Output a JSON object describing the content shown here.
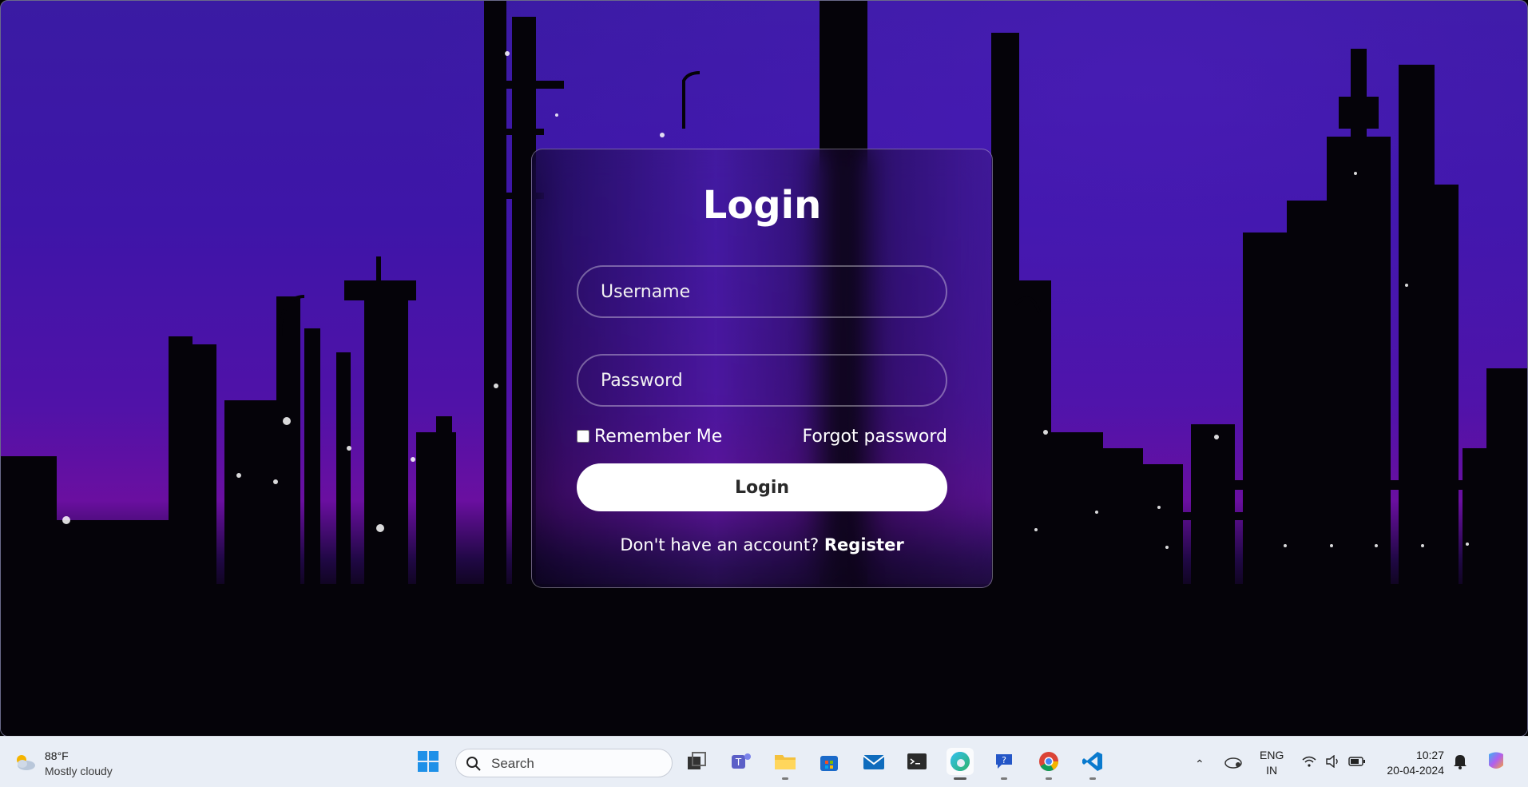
{
  "login": {
    "title": "Login",
    "username_placeholder": "Username",
    "password_placeholder": "Password",
    "remember_label": "Remember Me",
    "forgot_label": "Forgot password",
    "submit_label": "Login",
    "register_prompt": "Don't have an account?",
    "register_label": "Register"
  },
  "taskbar": {
    "weather": {
      "temp": "88°F",
      "desc": "Mostly cloudy",
      "icon": "partly-cloudy-icon"
    },
    "search_placeholder": "Search",
    "apps": [
      "windows-start-icon",
      "task-view-icon",
      "teams-icon",
      "file-explorer-icon",
      "microsoft-store-icon",
      "mail-icon",
      "terminal-icon",
      "edge-icon",
      "quick-assist-icon",
      "chrome-icon",
      "vscode-icon"
    ],
    "lang_line1": "ENG",
    "lang_line2": "IN",
    "time": "10:27",
    "date": "20-04-2024"
  },
  "colors": {
    "sky_top": "#3a1ba3",
    "sky_horizon": "#6a0fa0",
    "button_bg": "#ffffff",
    "taskbar_bg": "#e9eef6"
  }
}
